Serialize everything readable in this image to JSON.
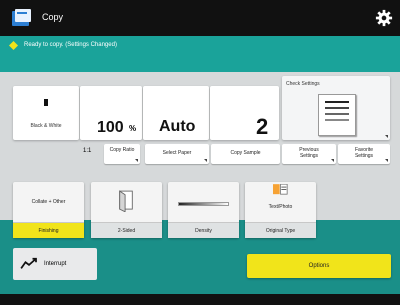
{
  "header": {
    "title": "Copy",
    "app_icon": "copy-icon",
    "settings_icon": "gear-icon"
  },
  "status": {
    "text": "Ready to copy. (Settings Changed)",
    "icon": "status-dot-icon"
  },
  "settings": {
    "color_mode": "Black & White",
    "ratio": "100",
    "ratio_unit": "%",
    "paper": "Auto",
    "copies": "2"
  },
  "quick_buttons": [
    {
      "prefix": "1:1",
      "label": "Copy Ratio"
    },
    {
      "label": "Select Paper"
    },
    {
      "label": "Copy Sample"
    },
    {
      "label": "Previous Settings"
    },
    {
      "label": "Favorite Settings"
    }
  ],
  "check_settings": {
    "label": "Check Settings"
  },
  "functions": [
    {
      "top": "Collate + Other",
      "label": "Finishing"
    },
    {
      "label": "2-Sided"
    },
    {
      "label": "Density"
    },
    {
      "top": "Text/Photo",
      "label": "Original Type"
    }
  ],
  "interrupt": {
    "label": "Interrupt"
  },
  "options": {
    "label": "Options"
  },
  "colors": {
    "teal": "#1aa39a",
    "teal_dark": "#1a8f88",
    "accent_yellow": "#f1e41a",
    "topbar": "#111111"
  }
}
